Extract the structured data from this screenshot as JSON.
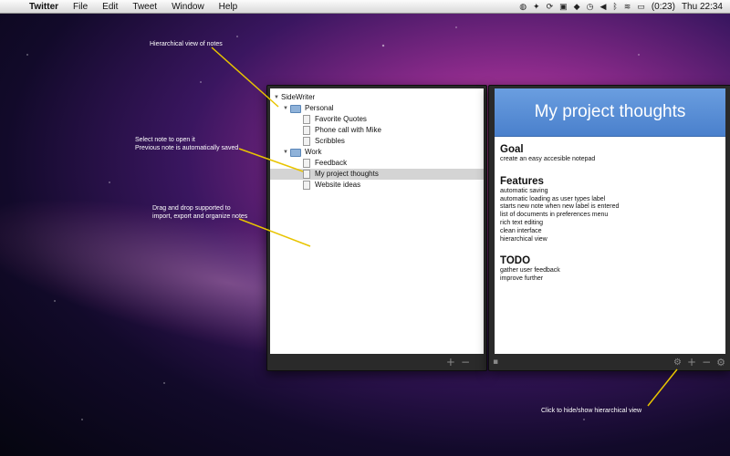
{
  "menubar": {
    "app_name": "Twitter",
    "menus": [
      "File",
      "Edit",
      "Tweet",
      "Window",
      "Help"
    ],
    "battery": "(0:23)",
    "clock": "Thu 22:34"
  },
  "tree": {
    "root": "SideWriter",
    "personal": "Personal",
    "favorite_quotes": "Favorite Quotes",
    "phone_call": "Phone call with Mike",
    "scribbles": "Scribbles",
    "work": "Work",
    "feedback": "Feedback",
    "project_thoughts": "My project thoughts",
    "website_ideas": "Website ideas"
  },
  "note": {
    "title": "My project thoughts",
    "goal_heading": "Goal",
    "goal_text": "create an easy accesible notepad",
    "features_heading": "Features",
    "features": [
      "automatic saving",
      "automatic loading as user types label",
      "starts new note when new label is entered",
      "list of documents in preferences menu",
      "rich text editing",
      "clean interface",
      "hierarchical view"
    ],
    "todo_heading": "TODO",
    "todo": [
      "gather user feedback",
      "improve further"
    ]
  },
  "annotations": {
    "hierarchical": "Hierarchical view of notes",
    "select_note_1": "Select note to open it",
    "select_note_2": "Previous note is automatically saved",
    "drag_drop_1": "Drag and drop supported to",
    "drag_drop_2": "import, export and organize notes",
    "hide_show": "Click to hide/show hierarchical view"
  },
  "footer": {
    "add": "+",
    "remove": "−"
  }
}
